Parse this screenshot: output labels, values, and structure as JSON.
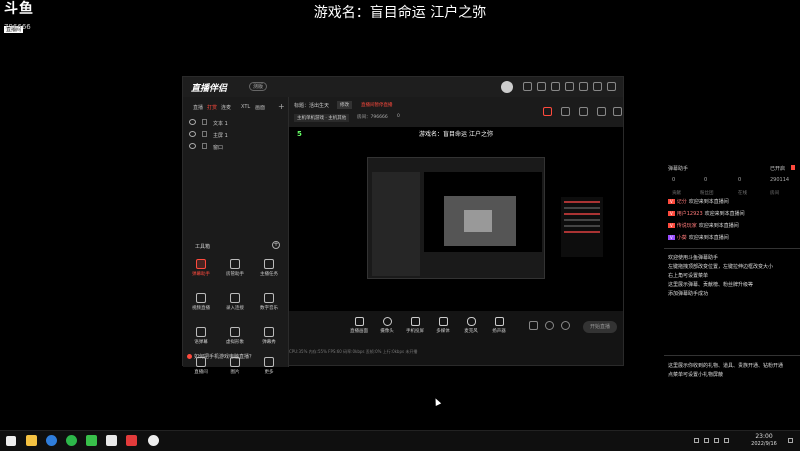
{
  "overlay": {
    "brand": "斗鱼",
    "brand_sub": "直播间",
    "room_id": "796666",
    "stream_title": "游戏名：盲目命运 江户之弥"
  },
  "app": {
    "name": "直播伴侣",
    "version_badge": "测版",
    "left_tabs": [
      "直播",
      "打赏",
      "连麦",
      "XTL",
      "画面"
    ],
    "scenes": [
      "文本 1",
      "主屏 1",
      "窗口"
    ],
    "toolbox_label": "工具箱",
    "tools": [
      {
        "label": "弹幕助手",
        "active": true
      },
      {
        "label": "房管助手",
        "active": false
      },
      {
        "label": "主播任务",
        "active": false
      },
      {
        "label": "视频直播",
        "active": false
      },
      {
        "label": "录入连接",
        "active": false
      },
      {
        "label": "数字音乐",
        "active": false
      },
      {
        "label": "语弹幕",
        "active": false
      },
      {
        "label": "虚拟形象",
        "active": false
      },
      {
        "label": "弹幕秀",
        "active": false
      },
      {
        "label": "直播间",
        "active": false
      },
      {
        "label": "图片",
        "active": false
      },
      {
        "label": "更多",
        "active": false
      }
    ],
    "tip": "如何把手机游戏电脑直播？",
    "stream_info": {
      "title": "标题：活出生天",
      "edit": "修改",
      "notice": "直播间暂停直播",
      "category": "主机单机游戏 · 主机其他",
      "room_label": "房间：796666",
      "count": "0"
    },
    "preview": {
      "score": "5",
      "title": "游戏名：盲目命运 江户之弥"
    },
    "controls": [
      "直播画面",
      "摄像头",
      "手机投屏",
      "多媒体",
      "麦克风",
      "扬声器"
    ],
    "go_live": "开始直播",
    "status_bar": "CPU:35%  内存:55%  FPS:60  码率:0kbps  丢帧:0%  上行:0kbps  未开播"
  },
  "right_panel": {
    "title": "弹幕助手",
    "status": "已开启",
    "stats": [
      "0",
      "0",
      "0",
      "290114"
    ],
    "labels": [
      "贡献",
      "粉丝团",
      "在线",
      "房间"
    ],
    "messages": [
      {
        "badge": "V",
        "name": "记分",
        "text": "欢迎来到本直播间"
      },
      {
        "badge": "V",
        "name": "用户12923",
        "text": "欢迎来到本直播间"
      },
      {
        "badge": "V",
        "name": "传说玩家",
        "text": "欢迎来到本直播间"
      },
      {
        "badge": "V",
        "name": "小葵",
        "text": "欢迎来到本直播间"
      }
    ],
    "help": [
      "欢迎使用斗鱼弹幕助手",
      "左键拖拽顶部改变位置，左键拉伸边框改变大小",
      "右上角可设置菜单",
      "这里展示弹幕、贡献榜、粉丝牌升级等",
      "添加弹幕助手成功"
    ],
    "help2": [
      "这里展示你收到的礼物、道具、贵族开通、钻粉开通",
      "点菜单可设置小礼物屏蔽"
    ]
  },
  "taskbar": {
    "time": "23:00",
    "date": "2022/9/16"
  },
  "colors": {
    "accent": "#ff4a3d",
    "background": "#000000",
    "panel": "#1b1b1b"
  }
}
